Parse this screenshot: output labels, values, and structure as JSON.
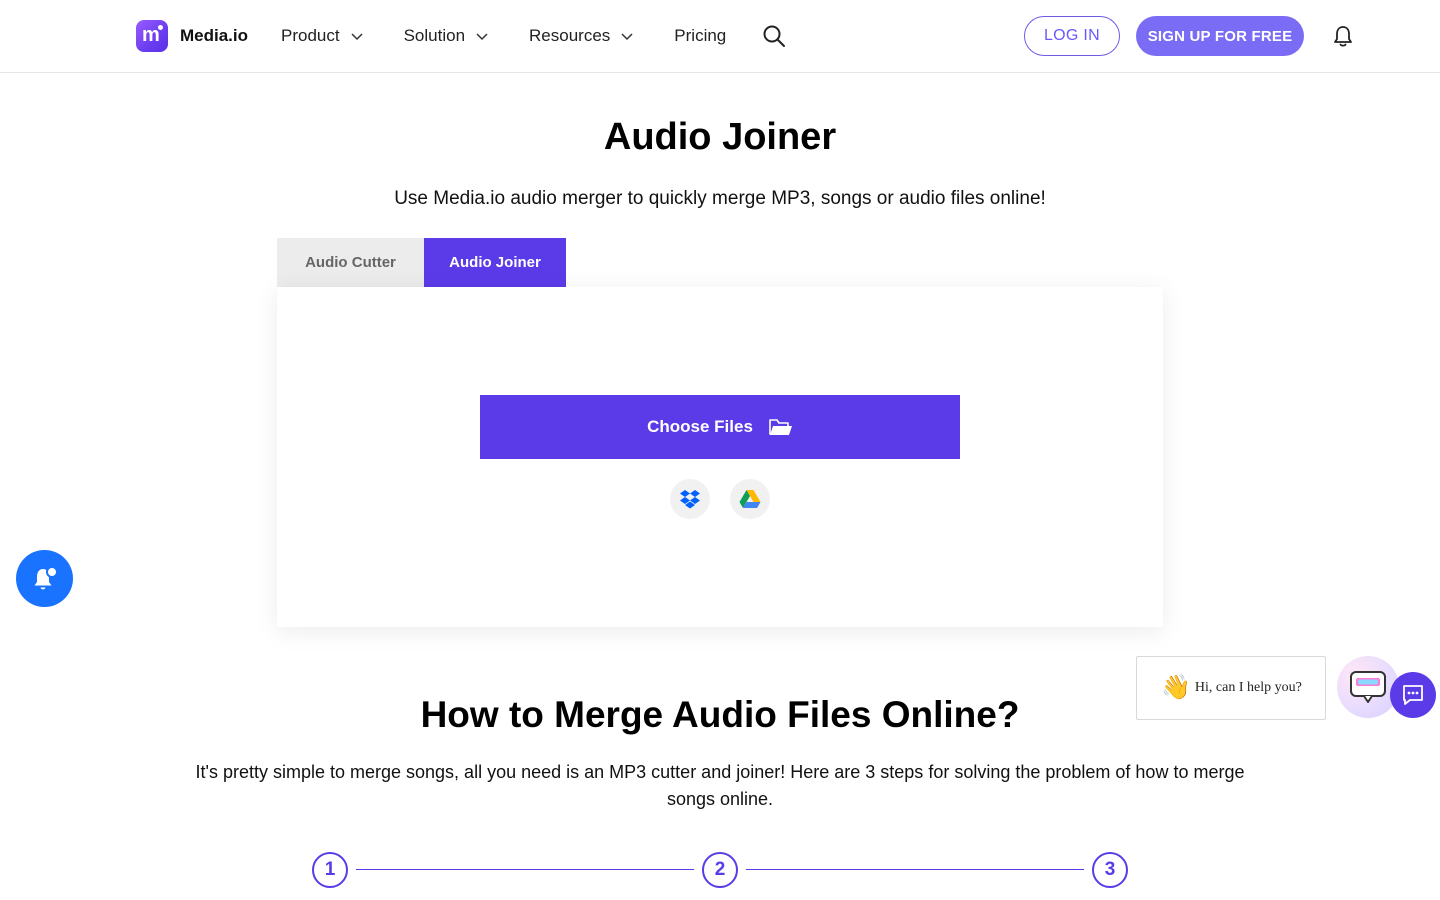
{
  "header": {
    "logo_text": "Media.io",
    "nav": [
      {
        "label": "Product",
        "has_dropdown": true
      },
      {
        "label": "Solution",
        "has_dropdown": true
      },
      {
        "label": "Resources",
        "has_dropdown": true
      },
      {
        "label": "Pricing",
        "has_dropdown": false
      }
    ],
    "login_label": "LOG IN",
    "signup_label": "SIGN UP FOR FREE",
    "icons": [
      "search-icon",
      "bell-icon"
    ]
  },
  "hero": {
    "title": "Audio Joiner",
    "subtitle": "Use Media.io audio merger to quickly merge MP3, songs or audio files online!"
  },
  "tabs": [
    {
      "label": "Audio Cutter",
      "active": false
    },
    {
      "label": "Audio Joiner",
      "active": true
    }
  ],
  "uploader": {
    "choose_label": "Choose Files",
    "cloud_sources": [
      "dropbox-icon",
      "google-drive-icon"
    ]
  },
  "chat": {
    "greeting": "Hi, can I help you?",
    "wave": "👋"
  },
  "how_to": {
    "title": "How to Merge Audio Files Online?",
    "description": "It's pretty simple to merge songs, all you need is an MP3 cutter and joiner! Here are 3 steps for solving the problem of how to merge songs online.",
    "steps": [
      "1",
      "2",
      "3"
    ]
  },
  "colors": {
    "brand": "#5b3be8",
    "signup": "#7b6cf6",
    "notify": "#1a73ff"
  }
}
